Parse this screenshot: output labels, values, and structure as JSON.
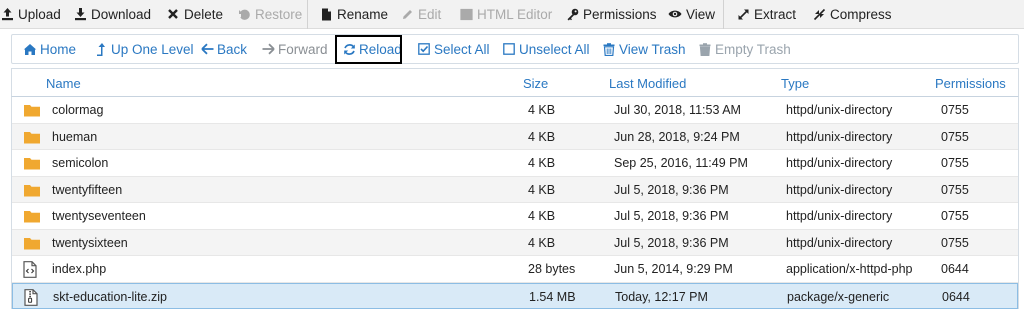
{
  "toolbar": {
    "upload": "Upload",
    "download": "Download",
    "delete": "Delete",
    "restore": "Restore",
    "rename": "Rename",
    "edit": "Edit",
    "html_editor": "HTML Editor",
    "permissions": "Permissions",
    "view": "View",
    "extract": "Extract",
    "compress": "Compress"
  },
  "nav": {
    "home": "Home",
    "up_one_level": "Up One Level",
    "back": "Back",
    "forward": "Forward",
    "reload": "Reload",
    "select_all": "Select All",
    "unselect_all": "Unselect All",
    "view_trash": "View Trash",
    "empty_trash": "Empty Trash"
  },
  "table": {
    "columns": {
      "name": "Name",
      "size": "Size",
      "last_modified": "Last Modified",
      "type": "Type",
      "permissions": "Permissions"
    },
    "rows": [
      {
        "icon": "folder-icon",
        "name": "colormag",
        "size": "4 KB",
        "modified": "Jul 30, 2018, 11:53 AM",
        "type": "httpd/unix-directory",
        "perms": "0755"
      },
      {
        "icon": "folder-icon",
        "name": "hueman",
        "size": "4 KB",
        "modified": "Jun 28, 2018, 9:24 PM",
        "type": "httpd/unix-directory",
        "perms": "0755"
      },
      {
        "icon": "folder-icon",
        "name": "semicolon",
        "size": "4 KB",
        "modified": "Sep 25, 2016, 11:49 PM",
        "type": "httpd/unix-directory",
        "perms": "0755"
      },
      {
        "icon": "folder-icon",
        "name": "twentyfifteen",
        "size": "4 KB",
        "modified": "Jul 5, 2018, 9:36 PM",
        "type": "httpd/unix-directory",
        "perms": "0755"
      },
      {
        "icon": "folder-icon",
        "name": "twentyseventeen",
        "size": "4 KB",
        "modified": "Jul 5, 2018, 9:36 PM",
        "type": "httpd/unix-directory",
        "perms": "0755"
      },
      {
        "icon": "folder-icon",
        "name": "twentysixteen",
        "size": "4 KB",
        "modified": "Jul 5, 2018, 9:36 PM",
        "type": "httpd/unix-directory",
        "perms": "0755"
      },
      {
        "icon": "code-file-icon",
        "name": "index.php",
        "size": "28 bytes",
        "modified": "Jun 5, 2014, 9:29 PM",
        "type": "application/x-httpd-php",
        "perms": "0644"
      },
      {
        "icon": "zip-file-icon",
        "name": "skt-education-lite.zip",
        "size": "1.54 MB",
        "modified": "Today, 12:17 PM",
        "type": "package/x-generic",
        "perms": "0644"
      }
    ]
  },
  "colors": {
    "link_blue": "#2a78c2",
    "folder_orange": "#f0a830",
    "selected_row": "#d9eaf7"
  }
}
